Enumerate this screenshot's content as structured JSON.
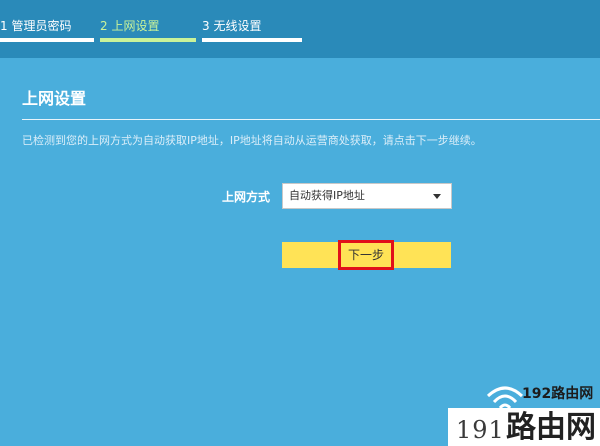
{
  "steps": [
    {
      "label": "1 管理员密码"
    },
    {
      "label": "2 上网设置"
    },
    {
      "label": "3 无线设置"
    }
  ],
  "page": {
    "title": "上网设置",
    "description": "已检测到您的上网方式为自动获取IP地址，IP地址将自动从运营商处获取，请点击下一步继续。"
  },
  "form": {
    "connection_type_label": "上网方式",
    "connection_type_value": "自动获得IP地址"
  },
  "buttons": {
    "next_label": "下一步"
  },
  "watermark": {
    "top_text": "192路由网",
    "number": "191",
    "name": "路由网"
  },
  "colors": {
    "background": "#4aaedc",
    "header": "#2a8ab9",
    "active_step": "#c9f39a",
    "next_button": "#ffe356",
    "highlight": "#e1101a"
  }
}
